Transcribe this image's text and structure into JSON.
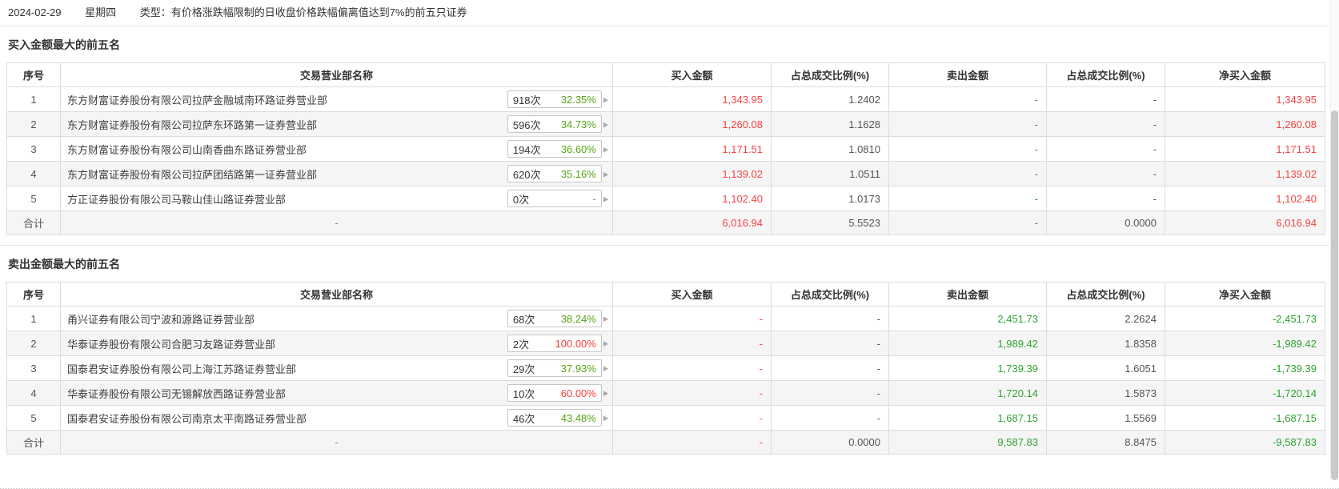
{
  "colors": {
    "up_red": "#f64444",
    "down_green": "#2fa22f",
    "badge_green": "#56a416",
    "badge_red": "#f63c3c"
  },
  "icons": {
    "expand_arrow": "▶"
  },
  "topbar": {
    "date": "2024-02-29",
    "weekday": "星期四",
    "type_label": "类型：",
    "type_text": "有价格涨跌幅限制的日收盘价格跌幅偏离值达到7%的前五只证券"
  },
  "columns": [
    "序号",
    "交易营业部名称",
    "买入金额",
    "占总成交比例(%)",
    "卖出金额",
    "占总成交比例(%)",
    "净买入金额"
  ],
  "buy_section": {
    "title": "买入金额最大的前五名",
    "value_colors": {
      "buy": "red",
      "sell": "green",
      "net": "red"
    },
    "rows": [
      {
        "no": "1",
        "name": "东方财富证券股份有限公司拉萨金融城南环路证券营业部",
        "count": "918次",
        "pct": "32.35%",
        "pct_class": "green",
        "buy": "1,343.95",
        "buy_ratio": "1.2402",
        "sell": "-",
        "sell_ratio": "-",
        "net": "1,343.95"
      },
      {
        "no": "2",
        "name": "东方财富证券股份有限公司拉萨东环路第一证券营业部",
        "count": "596次",
        "pct": "34.73%",
        "pct_class": "green",
        "buy": "1,260.08",
        "buy_ratio": "1.1628",
        "sell": "-",
        "sell_ratio": "-",
        "net": "1,260.08"
      },
      {
        "no": "3",
        "name": "东方财富证券股份有限公司山南香曲东路证券营业部",
        "count": "194次",
        "pct": "36.60%",
        "pct_class": "green",
        "buy": "1,171.51",
        "buy_ratio": "1.0810",
        "sell": "-",
        "sell_ratio": "-",
        "net": "1,171.51"
      },
      {
        "no": "4",
        "name": "东方财富证券股份有限公司拉萨团结路第一证券营业部",
        "count": "620次",
        "pct": "35.16%",
        "pct_class": "green",
        "buy": "1,139.02",
        "buy_ratio": "1.0511",
        "sell": "-",
        "sell_ratio": "-",
        "net": "1,139.02"
      },
      {
        "no": "5",
        "name": "方正证券股份有限公司马鞍山佳山路证券营业部",
        "count": "0次",
        "pct": "-",
        "pct_class": "muted",
        "buy": "1,102.40",
        "buy_ratio": "1.0173",
        "sell": "-",
        "sell_ratio": "-",
        "net": "1,102.40"
      }
    ],
    "total": {
      "no": "合计",
      "name": "-",
      "buy": "6,016.94",
      "buy_ratio": "5.5523",
      "sell": "-",
      "sell_ratio": "0.0000",
      "net": "6,016.94"
    }
  },
  "sell_section": {
    "title": "卖出金额最大的前五名",
    "value_colors": {
      "buy": "red",
      "sell": "green",
      "net": "green"
    },
    "rows": [
      {
        "no": "1",
        "name": "甬兴证券有限公司宁波和源路证券营业部",
        "count": "68次",
        "pct": "38.24%",
        "pct_class": "green",
        "buy": "-",
        "buy_ratio": "-",
        "sell": "2,451.73",
        "sell_ratio": "2.2624",
        "net": "-2,451.73"
      },
      {
        "no": "2",
        "name": "华泰证券股份有限公司合肥习友路证券营业部",
        "count": "2次",
        "pct": "100.00%",
        "pct_class": "red",
        "buy": "-",
        "buy_ratio": "-",
        "sell": "1,989.42",
        "sell_ratio": "1.8358",
        "net": "-1,989.42"
      },
      {
        "no": "3",
        "name": "国泰君安证券股份有限公司上海江苏路证券营业部",
        "count": "29次",
        "pct": "37.93%",
        "pct_class": "green",
        "buy": "-",
        "buy_ratio": "-",
        "sell": "1,739.39",
        "sell_ratio": "1.6051",
        "net": "-1,739.39"
      },
      {
        "no": "4",
        "name": "华泰证券股份有限公司无锡解放西路证券营业部",
        "count": "10次",
        "pct": "60.00%",
        "pct_class": "red",
        "buy": "-",
        "buy_ratio": "-",
        "sell": "1,720.14",
        "sell_ratio": "1.5873",
        "net": "-1,720.14"
      },
      {
        "no": "5",
        "name": "国泰君安证券股份有限公司南京太平南路证券营业部",
        "count": "46次",
        "pct": "43.48%",
        "pct_class": "green",
        "buy": "-",
        "buy_ratio": "-",
        "sell": "1,687.15",
        "sell_ratio": "1.5569",
        "net": "-1,687.15"
      }
    ],
    "total": {
      "no": "合计",
      "name": "-",
      "buy": "-",
      "buy_ratio": "0.0000",
      "sell": "9,587.83",
      "sell_ratio": "8.8475",
      "net": "-9,587.83"
    }
  }
}
